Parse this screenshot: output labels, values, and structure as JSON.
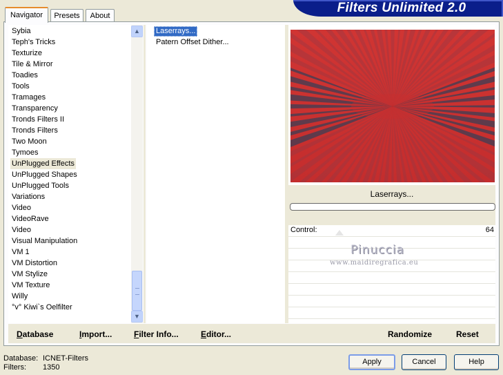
{
  "app": {
    "title": "Filters Unlimited 2.0"
  },
  "tabs": [
    {
      "label": "Navigator",
      "active": true
    },
    {
      "label": "Presets",
      "active": false
    },
    {
      "label": "About",
      "active": false
    }
  ],
  "categories": [
    "Sybia",
    "Teph's Tricks",
    "Texturize",
    "Tile & Mirror",
    "Toadies",
    "Tools",
    "Tramages",
    "Transparency",
    "Tronds Filters II",
    "Tronds Filters",
    "Two Moon",
    "Tymoes",
    "UnPlugged Effects",
    "UnPlugged Shapes",
    "UnPlugged Tools",
    "Variations",
    "Video",
    "VideoRave",
    "Video",
    "Visual Manipulation",
    "VM 1",
    "VM Distortion",
    "VM Stylize",
    "VM Texture",
    "Willy",
    "°v° Kiwi`s Oelfilter"
  ],
  "selected_category": "UnPlugged Effects",
  "scrollbar": {
    "up_icon": "chevron-up-icon",
    "down_icon": "chevron-down-icon"
  },
  "filters": [
    "Laserrays...",
    "Patern Offset Dither..."
  ],
  "selected_filter": "Laserrays...",
  "preview": {
    "filter_name": "Laserrays...",
    "colors": {
      "red": "#cc2f2e",
      "dark": "#3b3f55",
      "mid": "#8d3a47"
    }
  },
  "controls": [
    {
      "label": "Control:",
      "value": "64"
    }
  ],
  "watermark": {
    "name": "Pinuccia",
    "url": "www.maidiregrafica.eu"
  },
  "toolbar": {
    "database": "Database",
    "import": "Import...",
    "filter_info": "Filter Info...",
    "editor": "Editor...",
    "randomize": "Randomize",
    "reset": "Reset"
  },
  "status": {
    "database_label": "Database:",
    "database_value": "ICNET-Filters",
    "filters_label": "Filters:",
    "filters_value": "1350"
  },
  "buttons": {
    "apply": "Apply",
    "cancel": "Cancel",
    "help": "Help"
  },
  "accent": {
    "banner": "#0a1e8a",
    "selection": "#316ac5"
  }
}
